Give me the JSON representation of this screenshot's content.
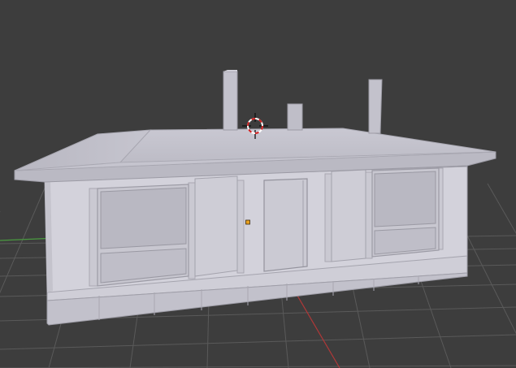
{
  "viewport": {
    "background_color": "#3d3d3d",
    "grid_color": "#5a5a5a",
    "x_axis_color": "#b03838",
    "y_axis_color": "#4a9a40"
  },
  "scene": {
    "object_type": "house",
    "chimney_count": 3,
    "window_count": 2,
    "door_count": 1,
    "cursor_icon": "3d-cursor-icon",
    "origin_icon": "object-origin-icon",
    "origin_color": "#e8a020"
  }
}
